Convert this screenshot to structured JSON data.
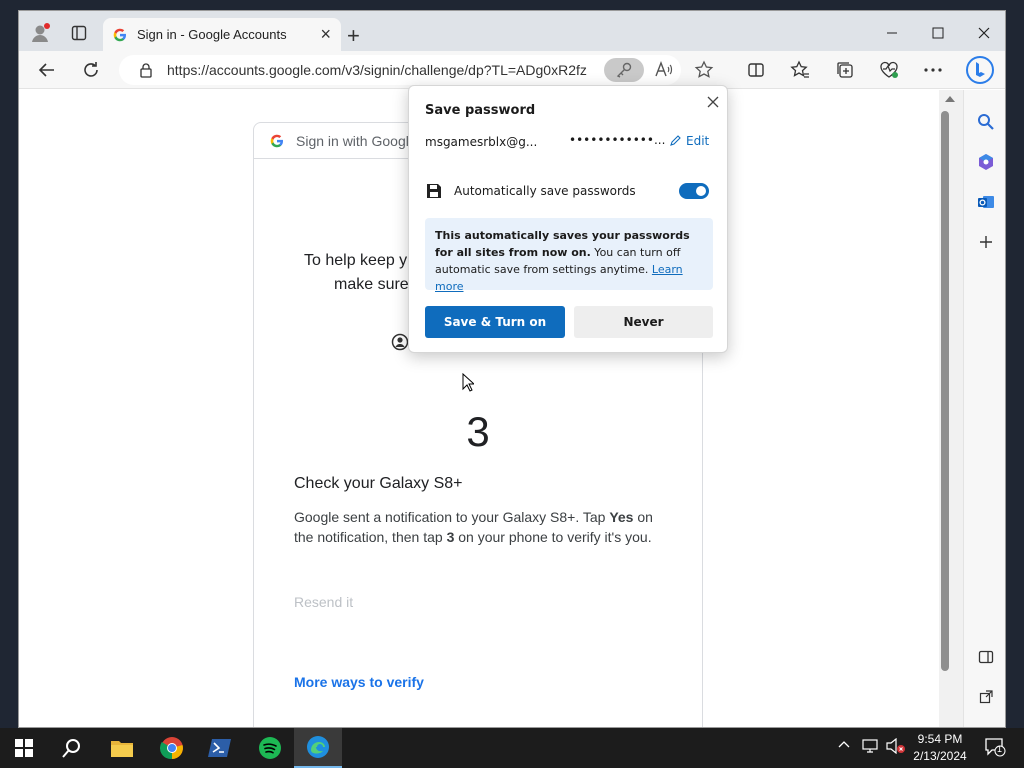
{
  "browser": {
    "tab_title": "Sign in - Google Accounts",
    "url": "https://accounts.google.com/v3/signin/challenge/dp?TL=ADg0xR2fz..."
  },
  "page": {
    "card_header": "Sign in with Google",
    "partial_line1": "To help keep y",
    "partial_line2": "make sure",
    "number": "3",
    "heading": "Check your Galaxy S8+",
    "body_a": "Google sent a notification to your Galaxy S8+. Tap ",
    "body_yes": "Yes",
    "body_b": " on the notification, then tap ",
    "body_3": "3",
    "body_c": " on your phone to verify it's you.",
    "resend": "Resend it",
    "more_ways": "More ways to verify"
  },
  "popup": {
    "title": "Save password",
    "username": "msgamesrblx@g...",
    "password": "••••••••••••...",
    "edit": "Edit",
    "auto_label": "Automatically save passwords",
    "info_bold": "This automatically saves your passwords for all sites from now on.",
    "info_rest": " You can turn off automatic save from settings anytime. ",
    "learn_more": "Learn more",
    "save_button": "Save & Turn on",
    "never_button": "Never",
    "auto_enabled": true
  },
  "taskbar": {
    "time": "9:54 PM",
    "date": "2/13/2024",
    "notification_count": "1"
  },
  "colors": {
    "accent": "#0f6cbd",
    "google_blue": "#1a73e8"
  }
}
